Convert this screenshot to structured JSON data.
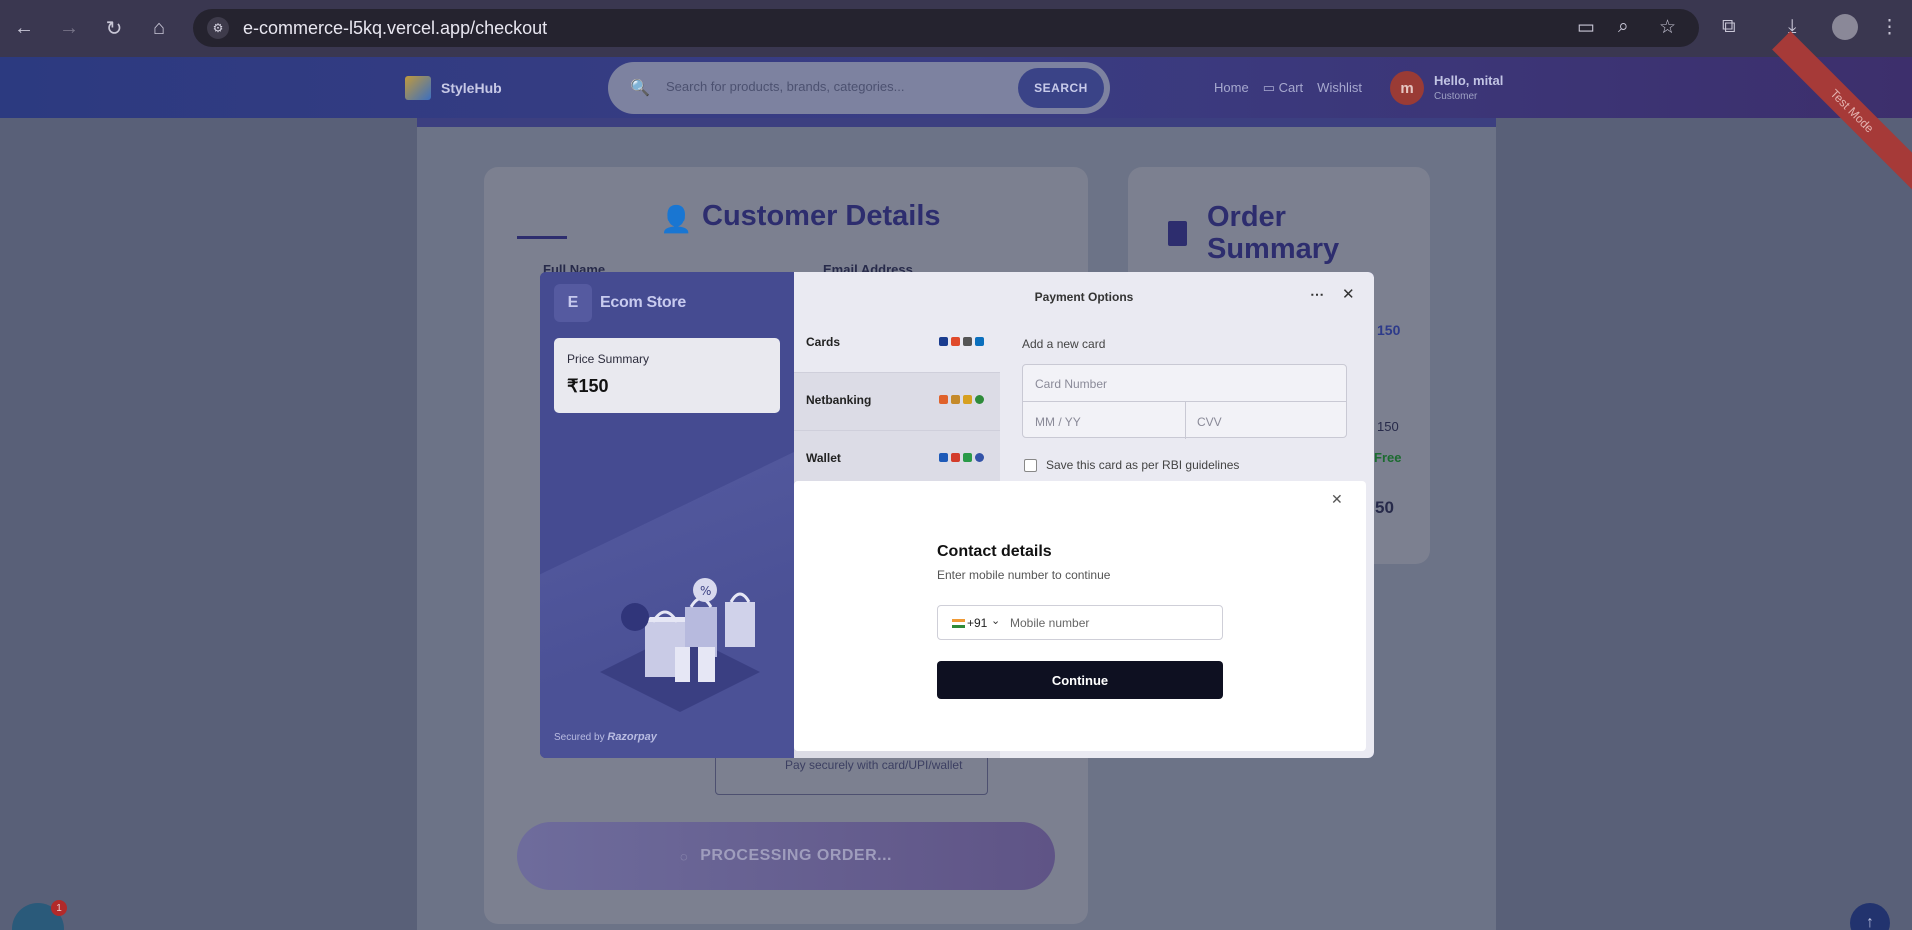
{
  "browser": {
    "url": "e-commerce-l5kq.vercel.app/checkout",
    "icons": [
      "back-arrow-icon",
      "forward-arrow-icon",
      "reload-icon",
      "home-icon",
      "site-info-icon",
      "install-app-icon",
      "zoom-icon",
      "star-icon",
      "extensions-icon",
      "download-icon",
      "profile-icon",
      "menu-icon"
    ]
  },
  "header": {
    "brand": "StyleHub",
    "search_placeholder": "Search for products, brands, categories...",
    "search_button": "SEARCH",
    "links": [
      "Home",
      "Cart",
      "Wishlist"
    ],
    "user_initial": "m",
    "user_greeting": "Hello, mital",
    "user_role": "Customer",
    "ribbon": "Test Mode"
  },
  "customer_details": {
    "title": "Customer Details",
    "full_name_label": "Full Name",
    "email_label": "Email Address",
    "pay_hint": "Pay securely with card/UPI/wallet",
    "process_button": "PROCESSING ORDER..."
  },
  "order_summary": {
    "title": "Order Summary",
    "amount_partial": "150",
    "subtotal_partial": "150",
    "shipping": "Free",
    "total_partial": "50"
  },
  "chat_badge": "1",
  "razorpay": {
    "merchant_initial": "E",
    "merchant_name": "Ecom Store",
    "price_summary_label": "Price Summary",
    "price": "₹150",
    "secured_by": "Secured by",
    "secured_brand": "Razorpay",
    "options_title": "Payment Options",
    "options": [
      {
        "name": "Cards"
      },
      {
        "name": "Netbanking"
      },
      {
        "name": "Wallet"
      }
    ],
    "add_card_label": "Add a new card",
    "card_number_placeholder": "Card Number",
    "expiry_placeholder": "MM / YY",
    "cvv_placeholder": "CVV",
    "save_card_label": "Save this card as per RBI guidelines"
  },
  "contact": {
    "title": "Contact details",
    "subtitle": "Enter mobile number to continue",
    "country_code": "+91",
    "phone_placeholder": "Mobile number",
    "continue_button": "Continue"
  }
}
